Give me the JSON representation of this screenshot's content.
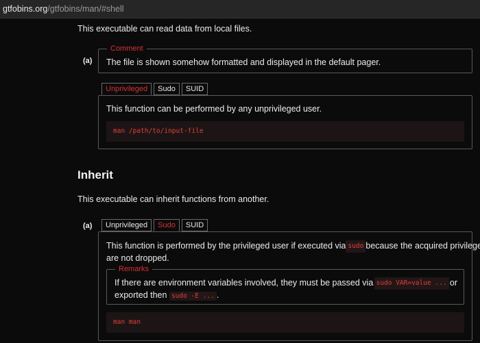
{
  "urlbar": {
    "host": "gtfobins.org",
    "path": "/gtfobins/man/#shell"
  },
  "shell": {
    "intro": "This executable can read data from local files.",
    "item_label": "(a)",
    "comment_legend": "Comment",
    "comment_text": "The file is shown somehow formatted and displayed in the default pager.",
    "tabs": [
      "Unprivileged",
      "Sudo",
      "SUID"
    ],
    "active_tab": "Unprivileged",
    "panel_text": "This function can be performed by any unprivileged user.",
    "code": "man /path/to/input-file"
  },
  "inherit": {
    "heading": "Inherit",
    "intro": "This executable can inherit functions from another.",
    "item_label": "(a)",
    "tabs": [
      "Unprivileged",
      "Sudo",
      "SUID"
    ],
    "active_tab": "Sudo",
    "panel_text_1": "This function is performed by the privileged user if executed via",
    "panel_code_1": "sudo",
    "panel_text_2": "because the acquired privileges",
    "panel_text_3": "are not dropped.",
    "remarks_legend": "Remarks",
    "remarks_text_1": "If there are environment variables involved, they must be passed via",
    "remarks_code_1": "sudo VAR=value ...",
    "remarks_text_2": "or",
    "remarks_text_3": "exported then",
    "remarks_code_2": "sudo -E ...",
    "remarks_text_4": ".",
    "code": "man man"
  },
  "colors": {
    "accent": "#d9312f",
    "background": "#0b0b0c",
    "code_bg": "#1d1515"
  }
}
